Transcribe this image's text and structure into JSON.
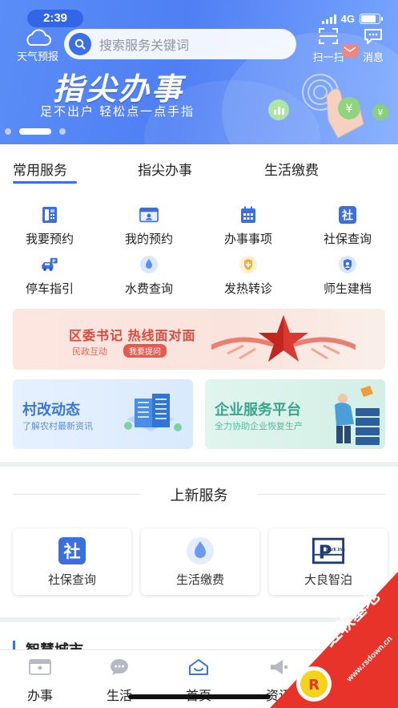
{
  "status_bar": {
    "time": "2:39",
    "network": "4G"
  },
  "header": {
    "weather_label": "天气预报",
    "search_placeholder": "搜索服务关键词",
    "scan_label": "扫一扫",
    "message_label": "消息"
  },
  "hero": {
    "title": "指尖办事",
    "subtitle": "足不出户 轻松点一点手指"
  },
  "tabs": [
    {
      "label": "常用服务"
    },
    {
      "label": "指尖办事"
    },
    {
      "label": "生活缴费"
    }
  ],
  "services": [
    {
      "label": "我要预约",
      "icon": "phone-booking-icon"
    },
    {
      "label": "我的预约",
      "icon": "id-card-icon"
    },
    {
      "label": "办事事项",
      "icon": "calendar-icon"
    },
    {
      "label": "社保查询",
      "icon": "social-security-icon"
    },
    {
      "label": "停车指引",
      "icon": "parking-car-icon"
    },
    {
      "label": "水费查询",
      "icon": "water-drop-icon"
    },
    {
      "label": "发热转诊",
      "icon": "fever-shield-icon"
    },
    {
      "label": "师生建档",
      "icon": "student-shield-icon"
    }
  ],
  "promo": {
    "title": "区委书记  热线面对面",
    "subtitle": "民政互动",
    "button": "我要提问"
  },
  "cards": [
    {
      "title": "村改动态",
      "subtitle": "了解农村最新资讯"
    },
    {
      "title": "企业服务平台",
      "subtitle": "全力协助企业恢复生产"
    }
  ],
  "new_services": {
    "title": "上新服务",
    "items": [
      {
        "label": "社保查询",
        "icon": "social-security-icon"
      },
      {
        "label": "生活缴费",
        "icon": "water-drop-icon"
      },
      {
        "label": "大良智泊",
        "icon": "parking-logo-icon",
        "logo_text": "Park ing"
      }
    ]
  },
  "smart_city": {
    "title": "智慧城市"
  },
  "bottom_nav": [
    {
      "label": "办事"
    },
    {
      "label": "生活"
    },
    {
      "label": "首页"
    },
    {
      "label": "资讯"
    }
  ],
  "watermark": {
    "text": "红软基地",
    "url": "www.rsdown.cn"
  },
  "colors": {
    "primary": "#3a6fe8",
    "hero_bg": "#5b8df7",
    "promo_red": "#e0483a"
  }
}
